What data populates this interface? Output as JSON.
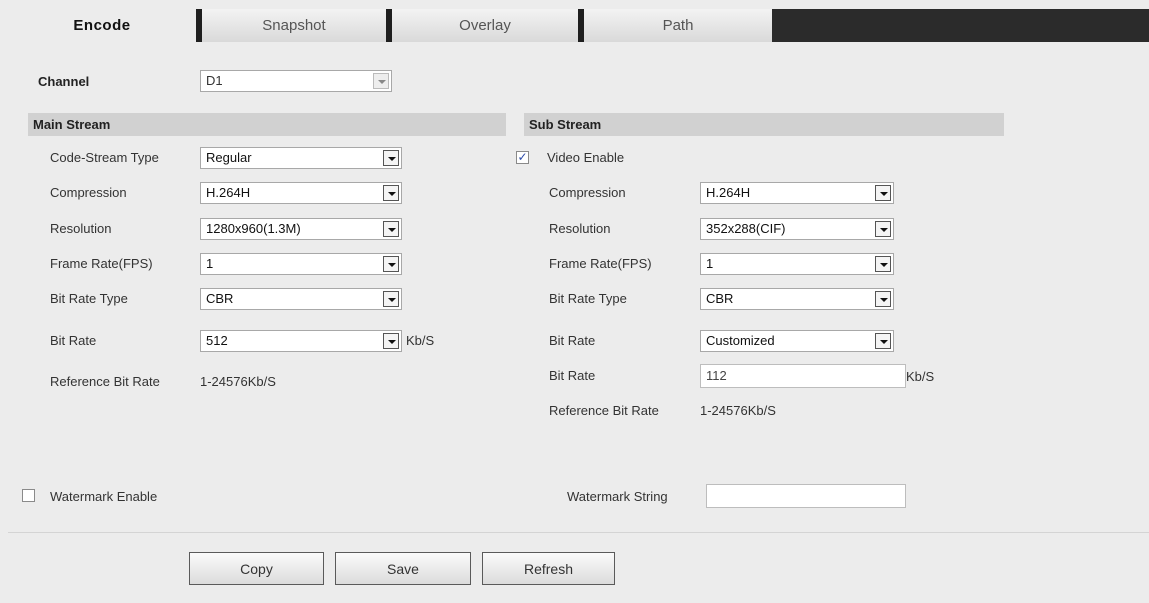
{
  "tabs": [
    "Encode",
    "Snapshot",
    "Overlay",
    "Path"
  ],
  "channel": {
    "label": "Channel",
    "value": "D1"
  },
  "main_stream": {
    "title": "Main Stream",
    "code_stream_type_label": "Code-Stream Type",
    "code_stream_type": "Regular",
    "compression_label": "Compression",
    "compression": "H.264H",
    "resolution_label": "Resolution",
    "resolution": "1280x960(1.3M)",
    "frame_rate_label": "Frame Rate(FPS)",
    "frame_rate": "1",
    "bit_rate_type_label": "Bit Rate Type",
    "bit_rate_type": "CBR",
    "bit_rate_label": "Bit Rate",
    "bit_rate": "512",
    "bit_rate_unit": "Kb/S",
    "reference_label": "Reference Bit Rate",
    "reference_value": "1-24576Kb/S"
  },
  "sub_stream": {
    "title": "Sub Stream",
    "video_enable_label": "Video Enable",
    "video_enable_checked": true,
    "compression_label": "Compression",
    "compression": "H.264H",
    "resolution_label": "Resolution",
    "resolution": "352x288(CIF)",
    "frame_rate_label": "Frame Rate(FPS)",
    "frame_rate": "1",
    "bit_rate_type_label": "Bit Rate Type",
    "bit_rate_type": "CBR",
    "bit_rate_label": "Bit Rate",
    "bit_rate": "Customized",
    "custom_bit_rate_label": "Bit Rate",
    "custom_bit_rate": "112",
    "custom_bit_rate_unit": "Kb/S",
    "reference_label": "Reference Bit Rate",
    "reference_value": "1-24576Kb/S"
  },
  "watermark": {
    "enable_label": "Watermark Enable",
    "enable_checked": false,
    "string_label": "Watermark String",
    "string_value": ""
  },
  "buttons": {
    "copy": "Copy",
    "save": "Save",
    "refresh": "Refresh"
  },
  "icons": {
    "dropdown": "chevron-down-icon",
    "checkbox": "checkbox-icon"
  },
  "colors": {
    "tabbar": "#2b2b2b",
    "section_header": "#d1d1d1",
    "background": "#ececec"
  }
}
